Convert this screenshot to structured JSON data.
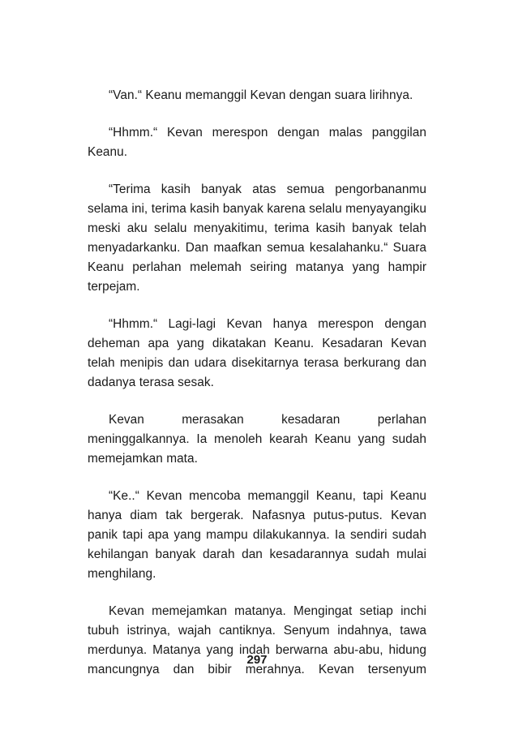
{
  "paragraphs": [
    "“Van.“ Keanu memanggil Kevan dengan suara lirihnya.",
    "“Hhmm.“ Kevan merespon dengan malas panggilan Keanu.",
    "“Terima kasih banyak atas semua pengorbananmu selama ini, terima kasih banyak karena selalu menyayangiku meski aku selalu menyakitimu, terima kasih banyak telah menyadarkanku. Dan maafkan semua kesalahanku.“ Suara Keanu perlahan melemah seiring matanya yang hampir terpejam.",
    "“Hhmm.“ Lagi-lagi Kevan hanya merespon dengan deheman apa yang dikatakan Keanu. Kesadaran Kevan telah menipis dan udara disekitarnya terasa berkurang dan dadanya terasa sesak.",
    "Kevan merasakan kesadaran perlahan meninggalkannya. Ia menoleh kearah Keanu yang sudah memejamkan mata.",
    "“Ke..“ Kevan mencoba memanggil Keanu, tapi Keanu hanya diam tak bergerak. Nafasnya putus-putus. Kevan panik tapi apa yang mampu dilakukannya. Ia sendiri sudah kehilangan banyak darah dan kesadarannya sudah mulai menghilang.",
    "Kevan memejamkan matanya. Mengingat setiap inchi tubuh istrinya, wajah cantiknya. Senyum indahnya, tawa merdunya. Matanya yang indah berwarna abu-abu, hidung mancungnya dan bibir merahnya. Kevan tersenyum"
  ],
  "page_number": "297"
}
